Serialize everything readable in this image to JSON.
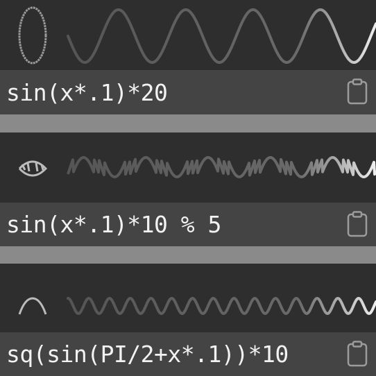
{
  "colors": {
    "background": "#2e2e2e",
    "expression_bar": "#444444",
    "separator": "#8a8a8a",
    "text": "#f2f2f2",
    "wave_dim": "#555555",
    "wave_bright": "#e8e8e8"
  },
  "icons": {
    "copy": "clipboard-icon"
  },
  "expressions": [
    {
      "text": "sin(x*.1)*20"
    },
    {
      "text": "sin(x*.1)*10 % 5"
    },
    {
      "text": "sq(sin(PI/2+x*.1))*10"
    }
  ]
}
